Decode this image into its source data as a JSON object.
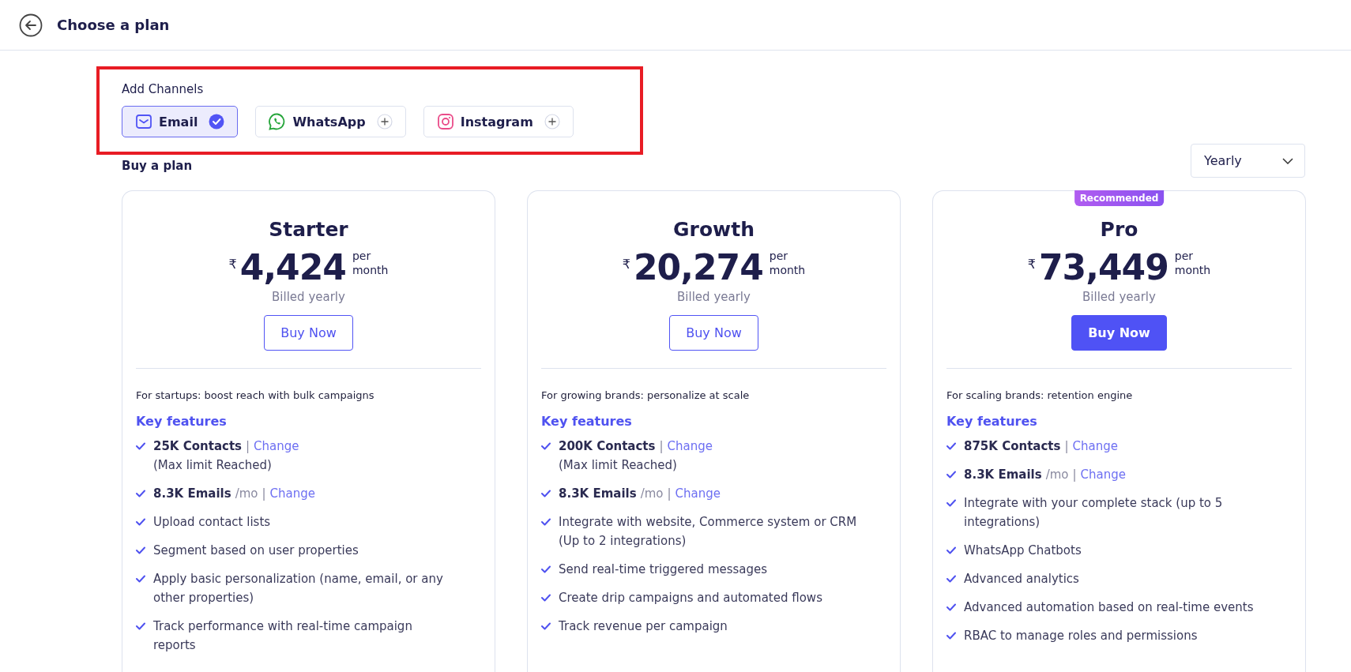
{
  "header": {
    "title": "Choose a plan"
  },
  "channels": {
    "title": "Add Channels",
    "items": [
      {
        "kind": "email",
        "label": "Email",
        "selected": true
      },
      {
        "kind": "whatsapp",
        "label": "WhatsApp",
        "selected": false
      },
      {
        "kind": "instagram",
        "label": "Instagram",
        "selected": false
      }
    ]
  },
  "plans_title": "Buy a plan",
  "billing_dropdown": {
    "value": "Yearly"
  },
  "plans": [
    {
      "name": "Starter",
      "currency": "₹",
      "price": "4,424",
      "period_top": "per",
      "period_bottom": "month",
      "billing": "Billed yearly",
      "button": "Buy Now",
      "highlighted": false,
      "tagline": "For startups: boost reach with bulk campaigns",
      "features_title": "Key features",
      "features": [
        {
          "kind": "quota",
          "amount": "25K Contacts",
          "separator": "|",
          "link": "Change",
          "note": "(Max limit Reached)"
        },
        {
          "kind": "quota",
          "amount": "8.3K Emails",
          "unit": "/mo",
          "separator": "|",
          "link": "Change"
        },
        {
          "kind": "text",
          "text": "Upload contact lists"
        },
        {
          "kind": "text",
          "text": "Segment based on user properties"
        },
        {
          "kind": "text",
          "text": "Apply basic personalization (name, email, or any other properties)"
        },
        {
          "kind": "text",
          "text": "Track performance with real-time campaign reports"
        }
      ]
    },
    {
      "name": "Growth",
      "currency": "₹",
      "price": "20,274",
      "period_top": "per",
      "period_bottom": "month",
      "billing": "Billed yearly",
      "button": "Buy Now",
      "highlighted": false,
      "tagline": "For growing brands: personalize at scale",
      "features_title": "Key features",
      "features": [
        {
          "kind": "quota",
          "amount": "200K Contacts",
          "separator": "|",
          "link": "Change",
          "note": "(Max limit Reached)"
        },
        {
          "kind": "quota",
          "amount": "8.3K Emails",
          "unit": "/mo",
          "separator": "|",
          "link": "Change"
        },
        {
          "kind": "text",
          "text": "Integrate with website, Commerce system or CRM (Up to 2 integrations)"
        },
        {
          "kind": "text",
          "text": "Send real-time triggered messages"
        },
        {
          "kind": "text",
          "text": "Create drip campaigns and automated flows"
        },
        {
          "kind": "text",
          "text": "Track revenue per campaign"
        }
      ]
    },
    {
      "name": "Pro",
      "badge": "Recommended",
      "currency": "₹",
      "price": "73,449",
      "period_top": "per",
      "period_bottom": "month",
      "billing": "Billed yearly",
      "button": "Buy Now",
      "highlighted": true,
      "tagline": "For scaling brands: retention engine",
      "features_title": "Key features",
      "features": [
        {
          "kind": "quota",
          "amount": "875K Contacts",
          "separator": "|",
          "link": "Change"
        },
        {
          "kind": "quota",
          "amount": "8.3K Emails",
          "unit": "/mo",
          "separator": "|",
          "link": "Change"
        },
        {
          "kind": "text",
          "text": "Integrate with your complete stack (up to 5 integrations)"
        },
        {
          "kind": "text",
          "text": "WhatsApp Chatbots"
        },
        {
          "kind": "text",
          "text": "Advanced analytics"
        },
        {
          "kind": "text",
          "text": "Advanced automation based on real-time events"
        },
        {
          "kind": "text",
          "text": "RBAC to manage roles and permissions"
        }
      ]
    }
  ]
}
